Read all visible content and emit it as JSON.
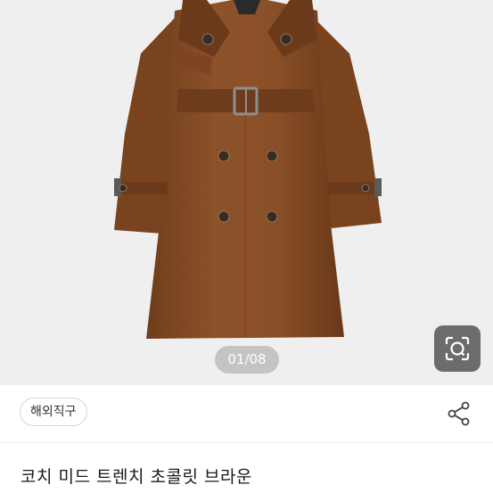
{
  "gallery": {
    "page_indicator": "01/08",
    "image_icon": "trench-coat-photo",
    "lens_icon": "image-search-icon",
    "coat_color": "#8a4f27"
  },
  "info": {
    "badge_label": "해외직구",
    "share_icon": "share-icon"
  },
  "product": {
    "title": "코치 미드 트렌치 초콜릿 브라운"
  }
}
